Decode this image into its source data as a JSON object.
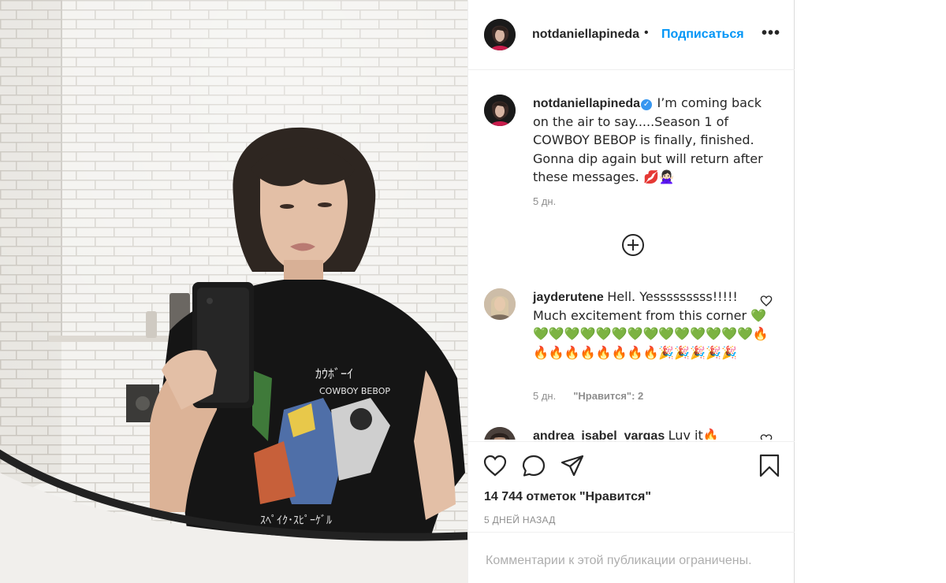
{
  "post": {
    "username": "notdaniellapineda",
    "separator": "•",
    "follow_label": "Подписаться",
    "more_icon": "more-options-icon",
    "caption": {
      "username": "notdaniellapineda",
      "text": "I’m coming back on the air to say.....Season 1 of COWBOY BEBOP is finally, finished. Gonna dip again but will return after these messages. 💋🙅🏻‍♀️",
      "time": "5 дн."
    },
    "load_more_icon": "plus-circle-icon"
  },
  "comments": [
    {
      "username": "jayderutene",
      "text": "Hell. Yesssssssss!!!!! Much excitement from this corner 💚💚💚💚💚💚💚💚💚💚💚💚💚💚💚🔥🔥🔥🔥🔥🔥🔥🔥🔥🎉🎉🎉🎉🎉",
      "time": "5 дн.",
      "likes": "\"Нравится\": 2"
    },
    {
      "username": "andrea_isabel_vargas",
      "text": "Luv it🔥"
    }
  ],
  "actions": {
    "like_icon": "heart-icon",
    "comment_icon": "comment-icon",
    "share_icon": "share-icon",
    "save_icon": "bookmark-icon",
    "likes_text": "14 744 отметок \"Нравится\"",
    "date_text": "5 ДНЕЙ НАЗАД"
  },
  "footer": {
    "restricted_text": "Комментарии к этой публикации ограничены."
  },
  "colors": {
    "accent": "#0095f6",
    "text": "#262626",
    "muted": "#8e8e8e",
    "border": "#efefef"
  }
}
